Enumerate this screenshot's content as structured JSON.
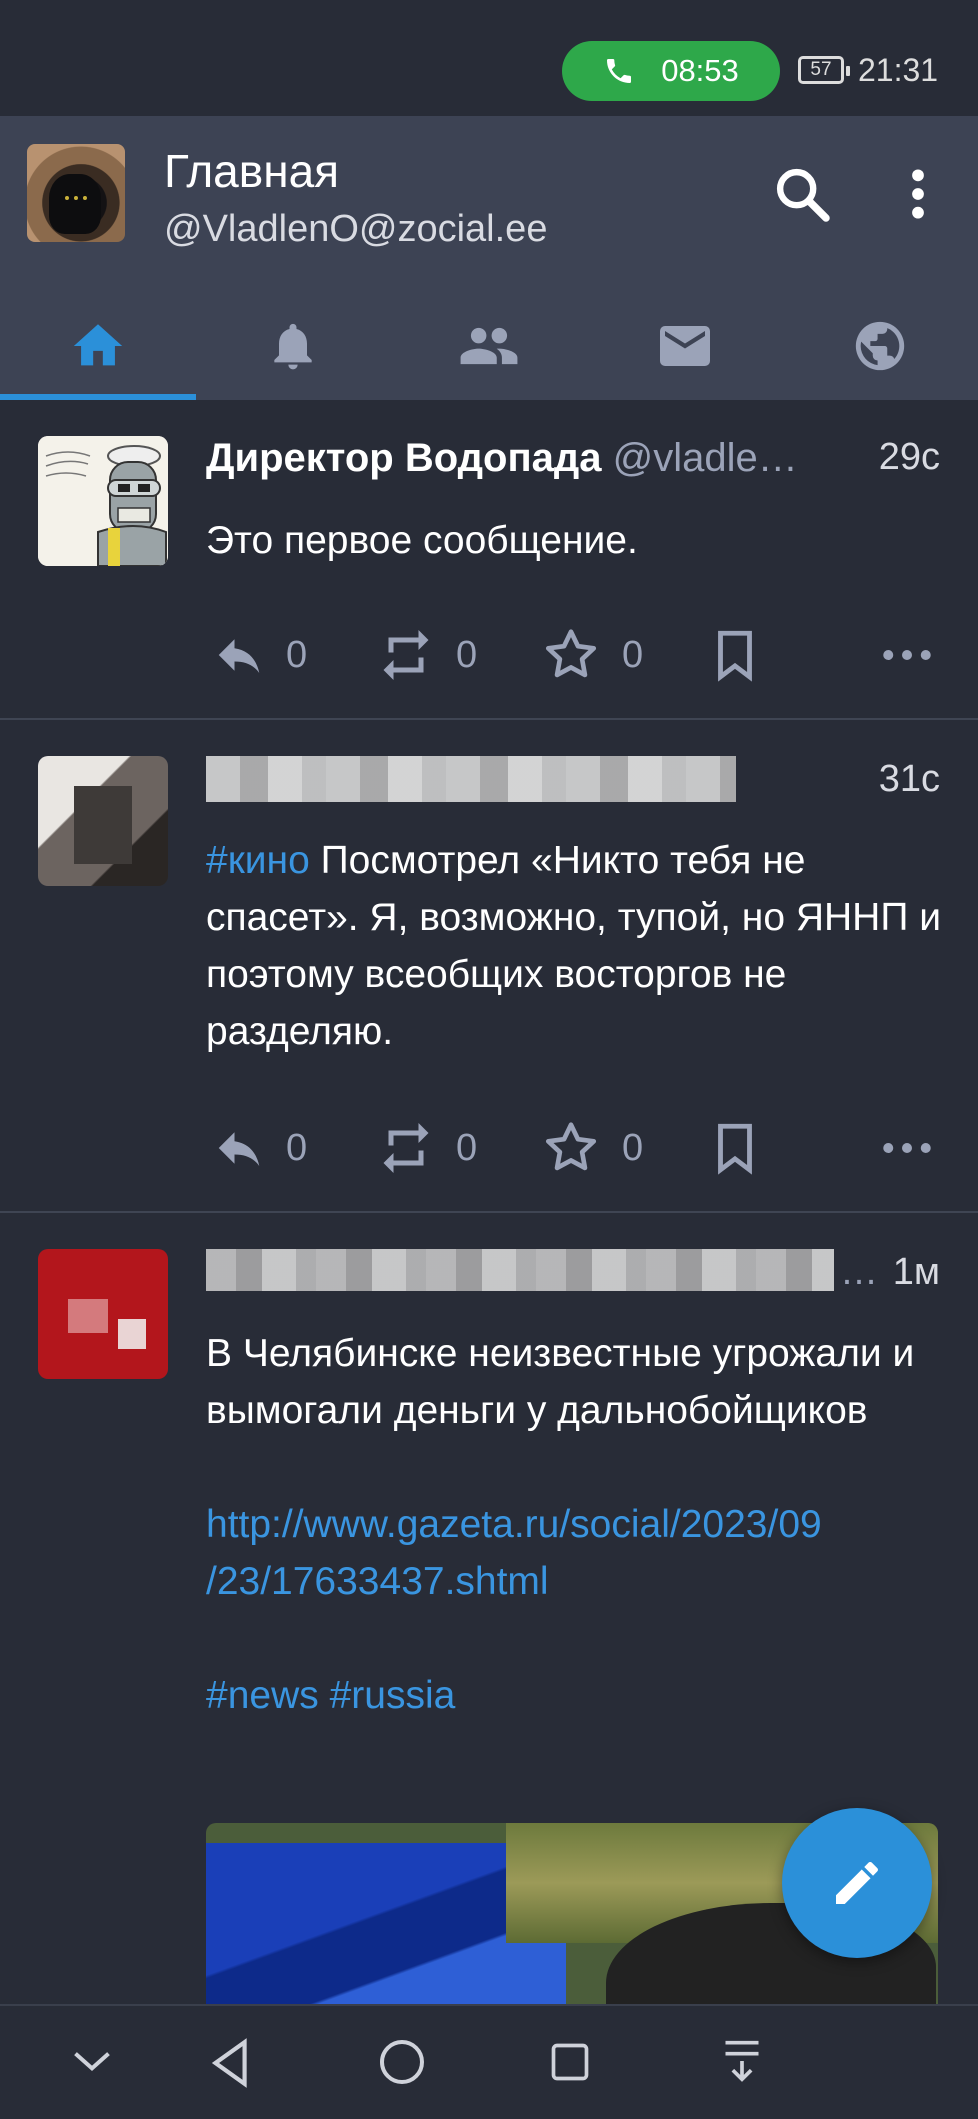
{
  "status_bar": {
    "call_time": "08:53",
    "battery": "57",
    "clock": "21:31"
  },
  "app_bar": {
    "title": "Главная",
    "account": "@VladlenO@zocial.ee"
  },
  "tabs": [
    {
      "name": "home-icon",
      "active": true
    },
    {
      "name": "bell-icon",
      "active": false
    },
    {
      "name": "people-icon",
      "active": false
    },
    {
      "name": "mail-icon",
      "active": false
    },
    {
      "name": "globe-icon",
      "active": false
    }
  ],
  "posts": [
    {
      "display_name": "Директор Водопада",
      "handle": "@vladle…",
      "time": "29с",
      "text": "Это первое сообщение.",
      "replies": "0",
      "boosts": "0",
      "favourites": "0"
    },
    {
      "display_name": "",
      "handle": "",
      "time": "31с",
      "hashtag": "#кино",
      "text": " Посмотрел «Никто тебя не спасет». Я, возможно, тупой, но ЯННП и поэтому всеобщих восторгов не разделяю.",
      "replies": "0",
      "boosts": "0",
      "favourites": "0"
    },
    {
      "display_name": "",
      "handle": "…",
      "time": "1м",
      "text": "В Челябинске неизвестные угрожали и вымогали деньги у дальнобойщиков",
      "url_line1": "http://www.gazeta.ru/social/2023/09",
      "url_line2": "/23/17633437.shtml",
      "tag1": "#news",
      "tag2": "#russia"
    }
  ],
  "colors": {
    "accent": "#2b90d9",
    "background": "#282c37",
    "appbar": "#3d4354",
    "call": "#2ea84a"
  }
}
